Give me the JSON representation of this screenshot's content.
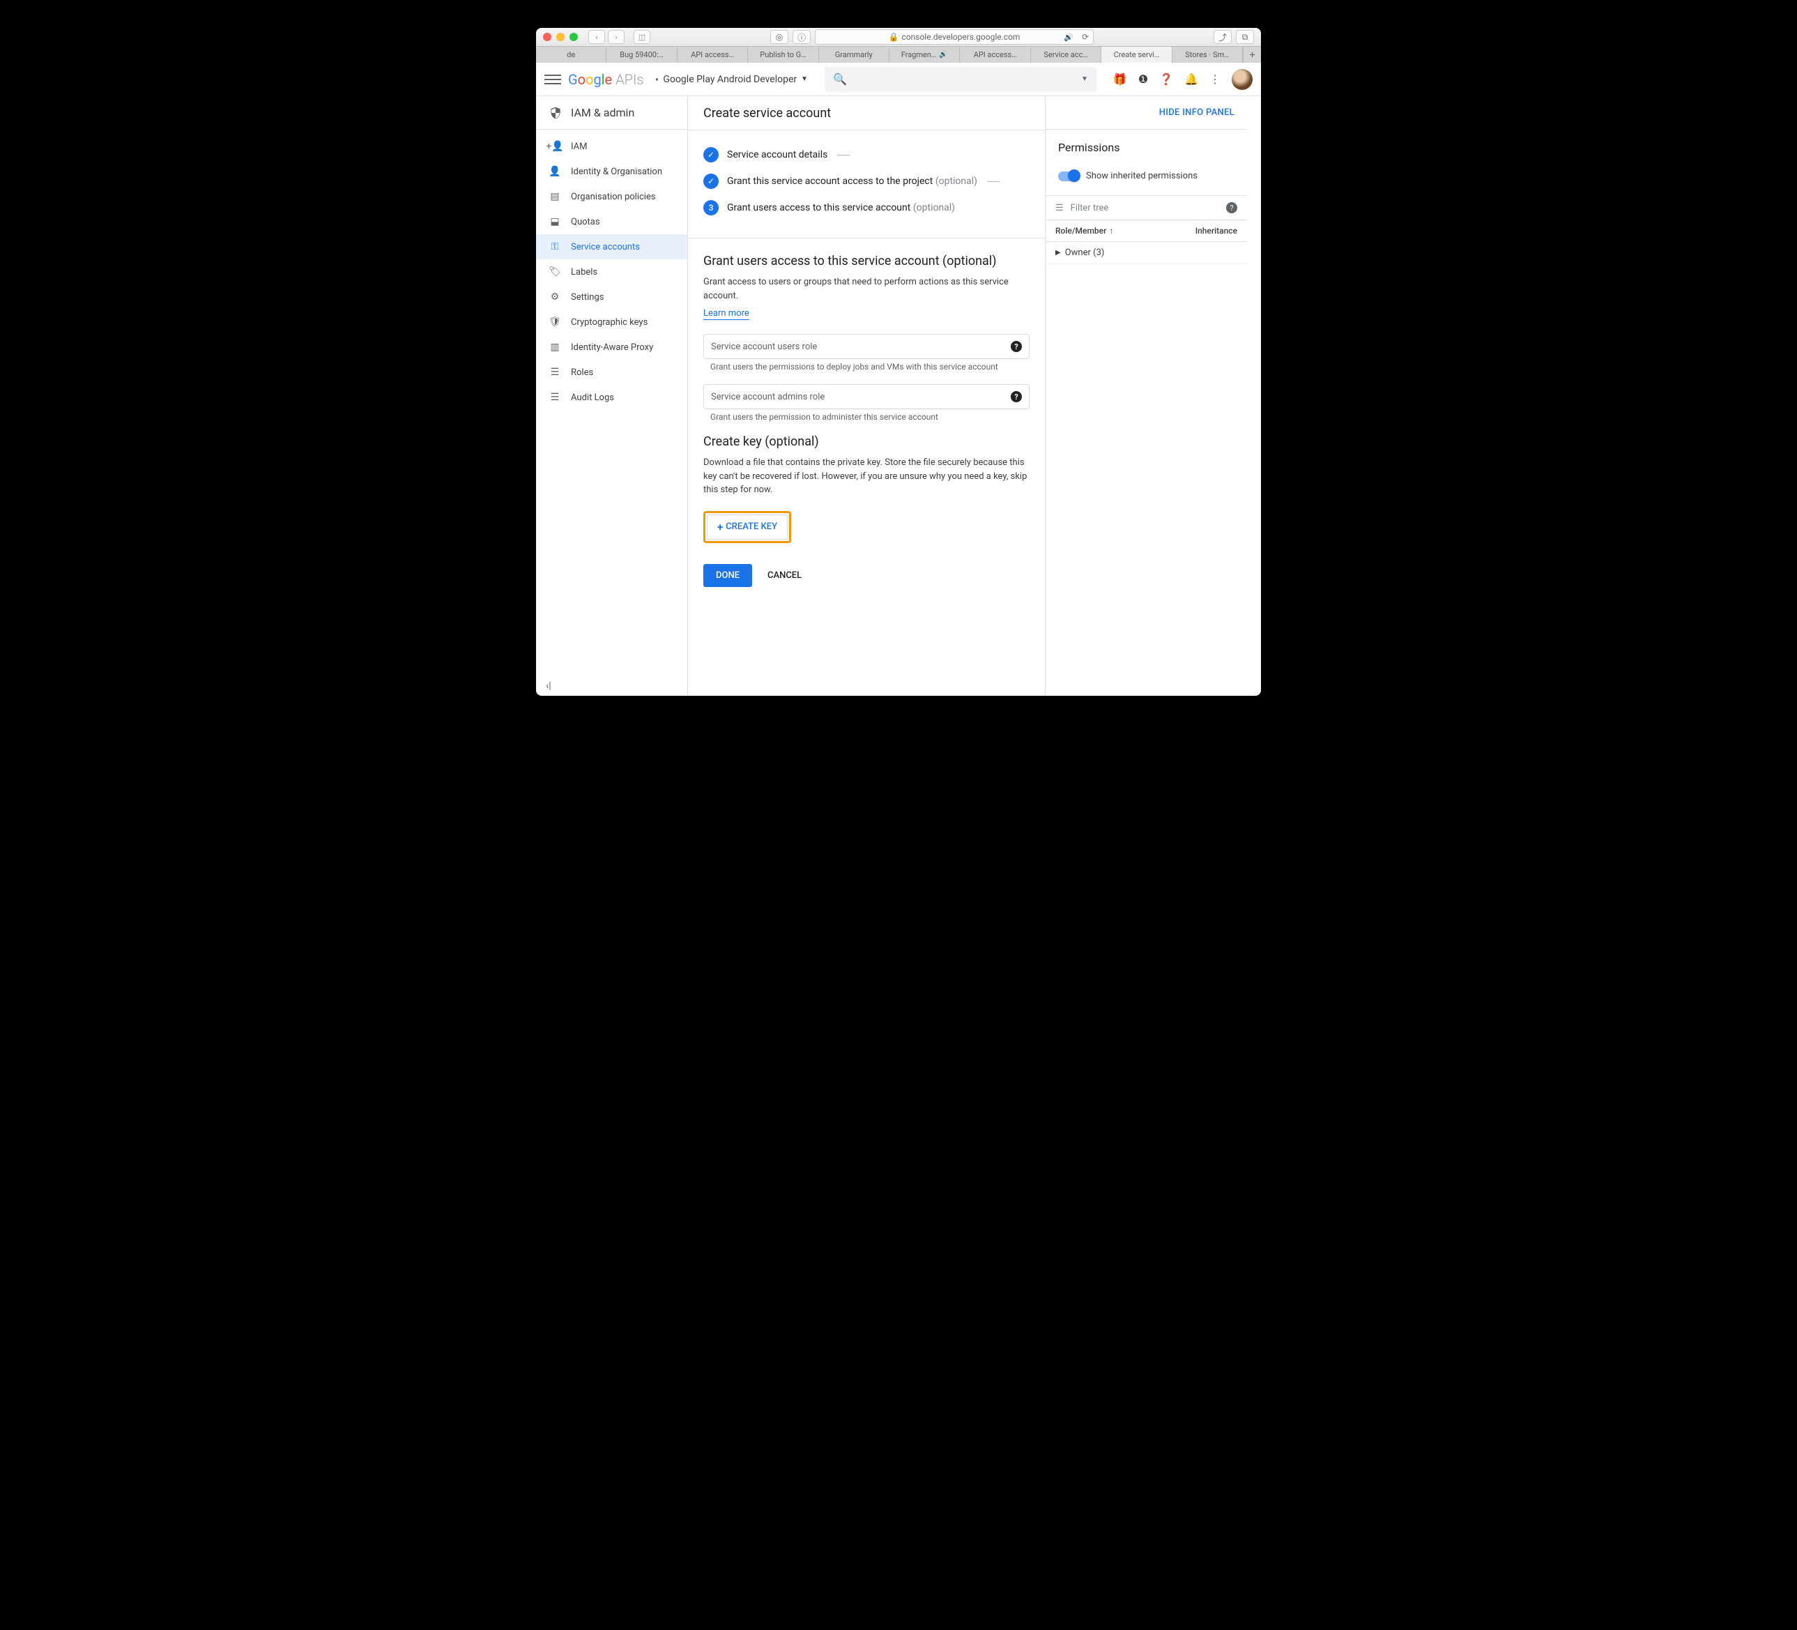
{
  "browser": {
    "url_host": "console.developers.google.com",
    "tabs": [
      "de",
      "Bug 59400:…",
      "API access…",
      "Publish to G…",
      "Grammarly",
      "Fragmen…",
      "API access…",
      "Service acc…",
      "Create servi…",
      "Stores · Sm…"
    ],
    "active_tab_index": 8,
    "sound_tab_index": 5
  },
  "header": {
    "logo_apis": "APIs",
    "project": "Google Play Android Developer"
  },
  "sidebar": {
    "title": "IAM & admin",
    "items": [
      "IAM",
      "Identity & Organisation",
      "Organisation policies",
      "Quotas",
      "Service accounts",
      "Labels",
      "Settings",
      "Cryptographic keys",
      "Identity-Aware Proxy",
      "Roles",
      "Audit Logs"
    ],
    "active_index": 4
  },
  "page": {
    "title": "Create service account",
    "hide_panel": "HIDE INFO PANEL",
    "steps": {
      "s1": "Service account details",
      "s2": "Grant this service account access to the project",
      "s2_opt": "(optional)",
      "s3_num": "3",
      "s3": "Grant users access to this service account",
      "s3_opt": "(optional)"
    },
    "grant": {
      "heading": "Grant users access to this service account (optional)",
      "desc": "Grant access to users or groups that need to perform actions as this service account.",
      "learn": "Learn more",
      "field1": "Service account users role",
      "hint1": "Grant users the permissions to deploy jobs and VMs with this service account",
      "field2": "Service account admins role",
      "hint2": "Grant users the permission to administer this service account"
    },
    "key": {
      "heading": "Create key (optional)",
      "desc": "Download a file that contains the private key. Store the file securely because this key can't be recovered if lost. However, if you are unsure why you need a key, skip this step for now.",
      "button": "CREATE KEY"
    },
    "done": "DONE",
    "cancel": "CANCEL"
  },
  "panel": {
    "title": "Permissions",
    "toggle_label": "Show inherited permissions",
    "filter_placeholder": "Filter tree",
    "col1": "Role/Member",
    "col2": "Inheritance",
    "row1": "Owner (3)"
  }
}
